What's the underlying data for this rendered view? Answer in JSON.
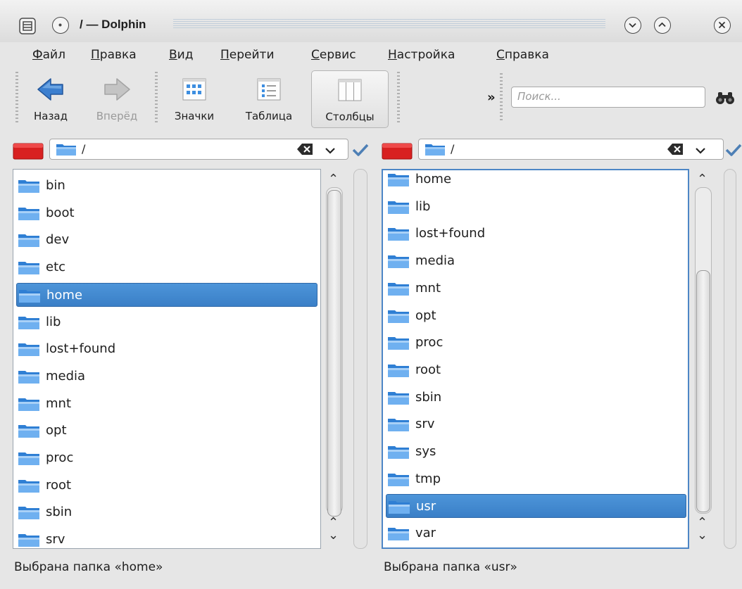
{
  "window": {
    "title": "/ — Dolphin"
  },
  "menu": [
    "Файл",
    "Правка",
    "Вид",
    "Перейти",
    "Сервис",
    "Настройка",
    "Справка"
  ],
  "toolbar": {
    "back": "Назад",
    "forward": "Вперёд",
    "icons_view": "Значки",
    "details_view": "Таблица",
    "columns_view": "Столбцы",
    "overflow": "»",
    "search_placeholder": "Поиск..."
  },
  "left_pane": {
    "path": "/",
    "items": [
      "bin",
      "boot",
      "dev",
      "etc",
      "home",
      "lib",
      "lost+found",
      "media",
      "mnt",
      "opt",
      "proc",
      "root",
      "sbin",
      "srv"
    ],
    "selected": "home",
    "status": "Выбрана папка «home»"
  },
  "right_pane": {
    "path": "/",
    "items": [
      "home",
      "lib",
      "lost+found",
      "media",
      "mnt",
      "opt",
      "proc",
      "root",
      "sbin",
      "srv",
      "sys",
      "tmp",
      "usr",
      "var"
    ],
    "selected": "usr",
    "status": "Выбрана папка «usr»"
  },
  "colors": {
    "selection": "#3d86cc",
    "active_border": "#4d86c6",
    "place_marker": "#d82020",
    "folder": "#3d8ee0"
  }
}
